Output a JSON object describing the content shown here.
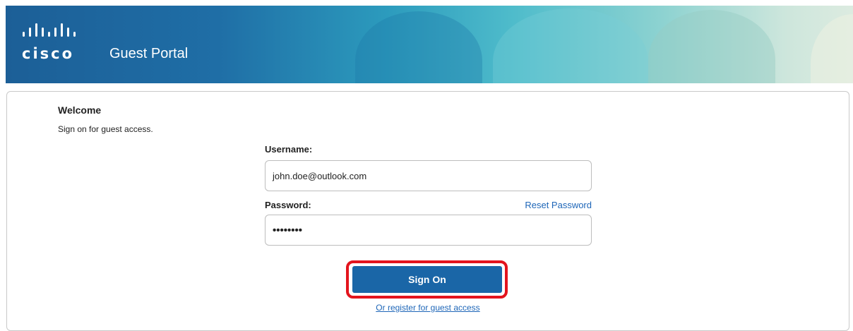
{
  "header": {
    "logo_text": "cisco",
    "title": "Guest Portal"
  },
  "form": {
    "welcome": "Welcome",
    "subtitle": "Sign on for guest access.",
    "username_label": "Username:",
    "username_value": "john.doe@outlook.com",
    "password_label": "Password:",
    "password_value": "••••••••",
    "reset_password": "Reset Password",
    "sign_on": "Sign On",
    "register": "Or register for guest access"
  },
  "colors": {
    "primary_button": "#1a66a7",
    "link": "#1e66b8",
    "highlight": "#e3141d"
  }
}
